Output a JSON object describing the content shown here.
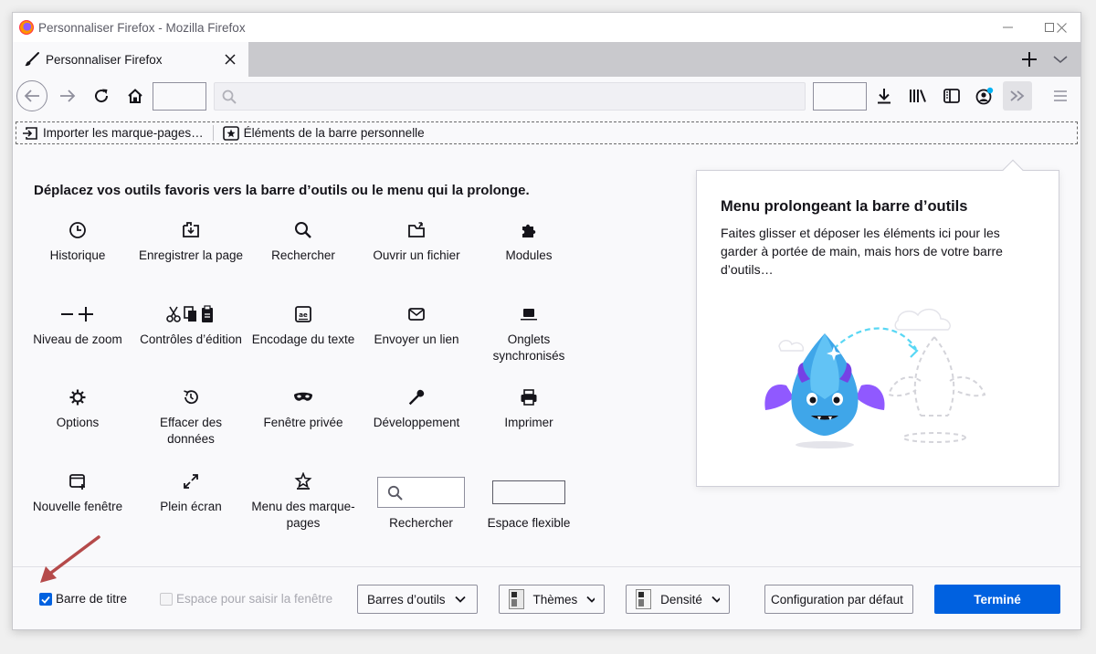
{
  "window": {
    "title": "Personnaliser Firefox - Mozilla Firefox"
  },
  "tab": {
    "label": "Personnaliser Firefox"
  },
  "bookmarks_toolbar": {
    "items": [
      {
        "label": "Importer les marque-pages…",
        "icon": "import-icon"
      },
      {
        "label": "Éléments de la barre personnelle",
        "icon": "star-box-icon"
      }
    ]
  },
  "content": {
    "headline": "Déplacez vos outils favoris vers la barre d’outils ou le menu qui la prolonge.",
    "palette": [
      {
        "label": "Historique",
        "icon": "history-icon"
      },
      {
        "label": "Enregistrer la page",
        "icon": "save-page-icon"
      },
      {
        "label": "Rechercher",
        "icon": "search-icon"
      },
      {
        "label": "Ouvrir un fichier",
        "icon": "open-file-icon"
      },
      {
        "label": "Modules",
        "icon": "puzzle-icon"
      },
      {
        "label": "Niveau de zoom",
        "icon": "zoom-controls-icon"
      },
      {
        "label": "Contrôles d’édition",
        "icon": "edit-controls-icon"
      },
      {
        "label": "Encodage du texte",
        "icon": "text-encoding-icon"
      },
      {
        "label": "Envoyer un lien",
        "icon": "mail-icon"
      },
      {
        "label": "Onglets synchronisés",
        "icon": "laptop-icon"
      },
      {
        "label": "Options",
        "icon": "gear-icon"
      },
      {
        "label": "Effacer des données",
        "icon": "forget-icon"
      },
      {
        "label": "Fenêtre privée",
        "icon": "mask-icon"
      },
      {
        "label": "Développement",
        "icon": "wrench-icon"
      },
      {
        "label": "Imprimer",
        "icon": "printer-icon"
      },
      {
        "label": "Nouvelle fenêtre",
        "icon": "new-window-icon"
      },
      {
        "label": "Plein écran",
        "icon": "fullscreen-icon"
      },
      {
        "label": "Menu des marque-pages",
        "icon": "bookmark-menu-icon"
      },
      {
        "label": "Rechercher",
        "icon": "search-box-widget"
      },
      {
        "label": "Espace flexible",
        "icon": "flexible-space-widget"
      }
    ]
  },
  "overflow_panel": {
    "title": "Menu prolongeant la barre d’outils",
    "description": "Faites glisser et déposer les éléments ici pour les garder à portée de main, mais hors de votre barre d’outils…"
  },
  "footer": {
    "titlebar_checkbox": {
      "label": "Barre de titre",
      "checked": true
    },
    "drag_space_checkbox": {
      "label": "Espace pour saisir la fenêtre",
      "checked": false,
      "disabled": true
    },
    "toolbars_button": "Barres d’outils",
    "themes_button": "Thèmes",
    "density_button": "Densité",
    "restore_defaults_button": "Configuration par défaut",
    "done_button": "Terminé"
  },
  "colors": {
    "accent": "#0061e0",
    "annotation_arrow": "#b54a4a"
  }
}
